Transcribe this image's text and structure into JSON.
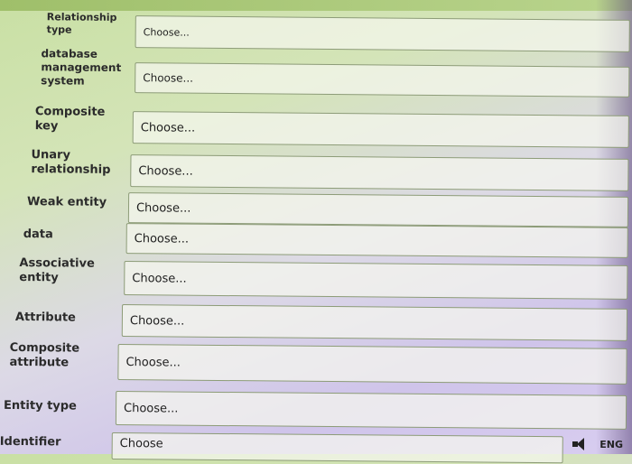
{
  "rows": [
    {
      "label": "Relationship type",
      "select": "Choose..."
    },
    {
      "label": "database management system",
      "select": "Choose..."
    },
    {
      "label": "Composite key",
      "select": "Choose..."
    },
    {
      "label": "Unary relationship",
      "select": "Choose..."
    },
    {
      "label": "Weak entity",
      "select": "Choose..."
    },
    {
      "label": "data",
      "select": "Choose..."
    },
    {
      "label": "Associative entity",
      "select": "Choose..."
    },
    {
      "label": "Attribute",
      "select": "Choose..."
    },
    {
      "label": "Composite attribute",
      "select": "Choose..."
    },
    {
      "label": "Entity type",
      "select": "Choose..."
    },
    {
      "label": "Identifier",
      "select": "Choose"
    }
  ],
  "taskbar": {
    "language": "ENG"
  }
}
